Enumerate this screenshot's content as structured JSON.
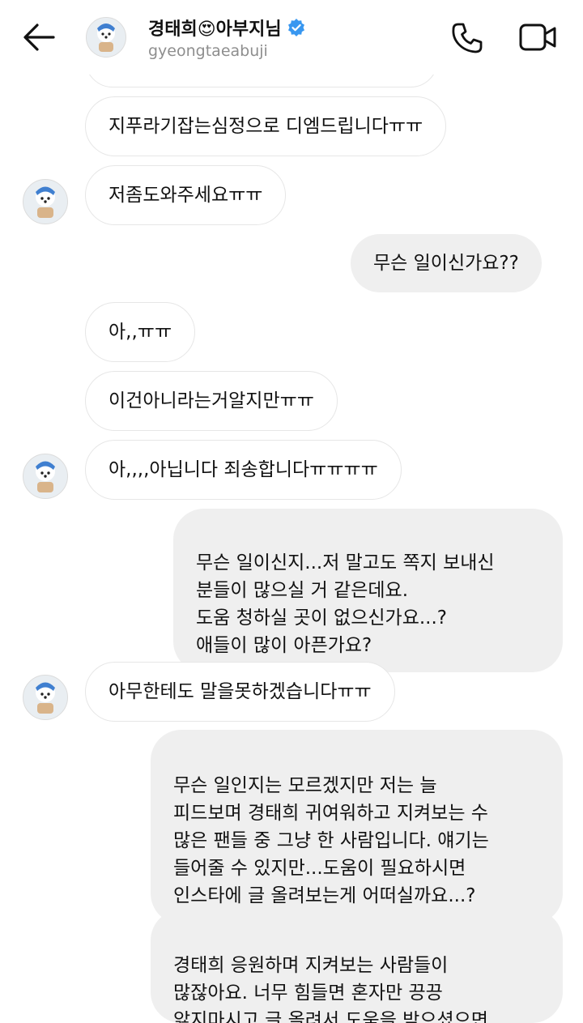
{
  "header": {
    "name": "경태희😍아부지님",
    "handle": "gyeongtaeabuji"
  },
  "messages": [
    {
      "side": "in",
      "text": "지푸라기잡는심정으로 디엠드립니다ㅠㅠ"
    },
    {
      "side": "in",
      "text": "저좀도와주세요ㅠㅠ"
    },
    {
      "side": "out",
      "text": "무슨 일이신가요??"
    },
    {
      "side": "in",
      "text": "아,,ㅠㅠ"
    },
    {
      "side": "in",
      "text": "이건아니라는거알지만ㅠㅠ"
    },
    {
      "side": "in",
      "text": "아,,,,아닙니다 죄송합니다ㅠㅠㅠㅠ"
    },
    {
      "side": "out",
      "text": "무슨 일이신지...저 말고도 쪽지 보내신\n분들이 많으실 거 같은데요.\n도움 청하실 곳이 없으신가요...?\n애들이 많이 아픈가요?"
    },
    {
      "side": "in",
      "text": "아무한테도 말을못하겠습니다ㅠㅠ"
    },
    {
      "side": "out",
      "text": "무슨 일인지는 모르겠지만 저는 늘\n피드보며 경태희 귀여워하고 지켜보는 수\n많은 팬들 중 그냥 한 사람입니다. 얘기는\n들어줄 수 있지만...도움이 필요하시면\n인스타에 글 올려보는게 어떠실까요...?"
    },
    {
      "side": "out",
      "text": "경태희 응원하며 지켜보는 사람들이\n많잖아요. 너무 힘들면 혼자만 끙끙\n앓지마시고  글 올려서 도움을 받으셨으면"
    }
  ]
}
